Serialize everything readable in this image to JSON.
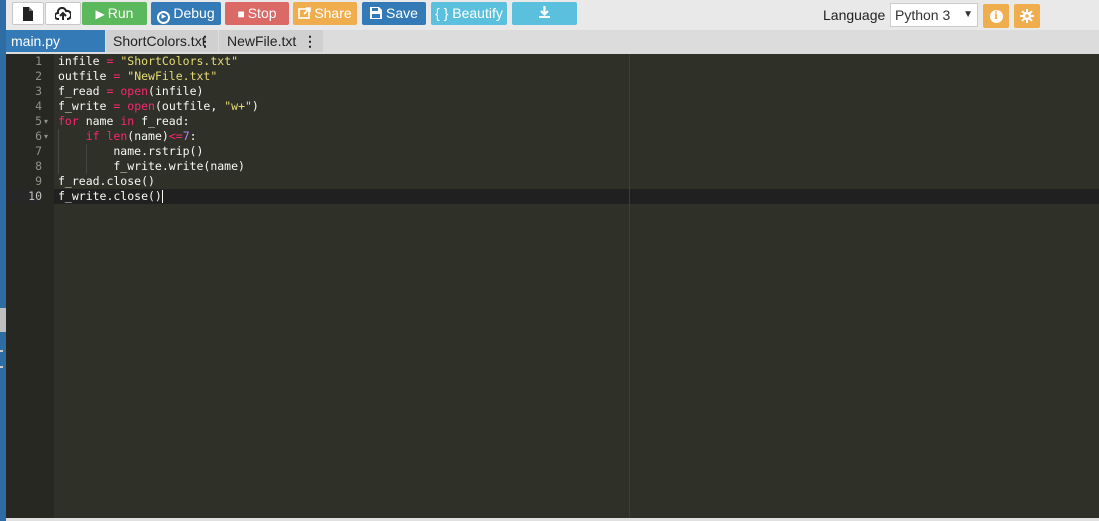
{
  "toolbar": {
    "run_label": "Run",
    "debug_label": "Debug",
    "stop_label": "Stop",
    "share_label": "Share",
    "save_label": "Save",
    "beautify_label": "{ } Beautify",
    "language_label": "Language",
    "language_value": "Python 3",
    "icons": {
      "new": "new-file-icon",
      "upload": "upload-icon",
      "run": "play-icon",
      "debug": "debug-icon",
      "stop": "stop-icon",
      "share": "share-icon",
      "save": "save-icon",
      "download": "download-icon",
      "info": "info-icon",
      "settings": "gear-icon"
    },
    "colors": {
      "run": "#5cb85c",
      "primary": "#337ab7",
      "danger": "#d9534f",
      "warning": "#f0ad4e",
      "info": "#5bc0de"
    }
  },
  "tabs": [
    {
      "label": "main.py"
    },
    {
      "label": "ShortColors.txt"
    },
    {
      "label": "NewFile.txt"
    }
  ],
  "editor": {
    "active_line": 10,
    "lines": [
      {
        "num": "1",
        "tokens": [
          [
            "t-default",
            "infile "
          ],
          [
            "t-op",
            "="
          ],
          [
            "t-default",
            " "
          ],
          [
            "t-str",
            "\"ShortColors.txt\""
          ]
        ]
      },
      {
        "num": "2",
        "tokens": [
          [
            "t-default",
            "outfile "
          ],
          [
            "t-op",
            "="
          ],
          [
            "t-default",
            " "
          ],
          [
            "t-str",
            "\"NewFile.txt\""
          ]
        ]
      },
      {
        "num": "3",
        "tokens": [
          [
            "t-default",
            "f_read "
          ],
          [
            "t-op",
            "="
          ],
          [
            "t-default",
            " "
          ],
          [
            "t-builtin",
            "open"
          ],
          [
            "t-default",
            "(infile)"
          ]
        ]
      },
      {
        "num": "4",
        "tokens": [
          [
            "t-default",
            "f_write "
          ],
          [
            "t-op",
            "="
          ],
          [
            "t-default",
            " "
          ],
          [
            "t-builtin",
            "open"
          ],
          [
            "t-default",
            "(outfile, "
          ],
          [
            "t-str",
            "\"w+\""
          ],
          [
            "t-default",
            ")"
          ]
        ]
      },
      {
        "num": "5",
        "fold": true,
        "tokens": [
          [
            "t-kw",
            "for"
          ],
          [
            "t-default",
            " name "
          ],
          [
            "t-kw",
            "in"
          ],
          [
            "t-default",
            " f_read:"
          ]
        ]
      },
      {
        "num": "6",
        "fold": true,
        "tokens": [
          [
            "t-default",
            "    "
          ],
          [
            "t-kw",
            "if"
          ],
          [
            "t-default",
            " "
          ],
          [
            "t-builtin",
            "len"
          ],
          [
            "t-default",
            "(name)"
          ],
          [
            "t-op",
            "<="
          ],
          [
            "t-num",
            "7"
          ],
          [
            "t-default",
            ":"
          ]
        ]
      },
      {
        "num": "7",
        "tokens": [
          [
            "t-default",
            "        name.rstrip()"
          ]
        ]
      },
      {
        "num": "8",
        "tokens": [
          [
            "t-default",
            "        f_write.write(name)"
          ]
        ]
      },
      {
        "num": "9",
        "tokens": [
          [
            "t-default",
            "f_read.close()"
          ]
        ]
      },
      {
        "num": "10",
        "tokens": [
          [
            "t-default",
            "f_write.close()"
          ]
        ]
      }
    ]
  }
}
